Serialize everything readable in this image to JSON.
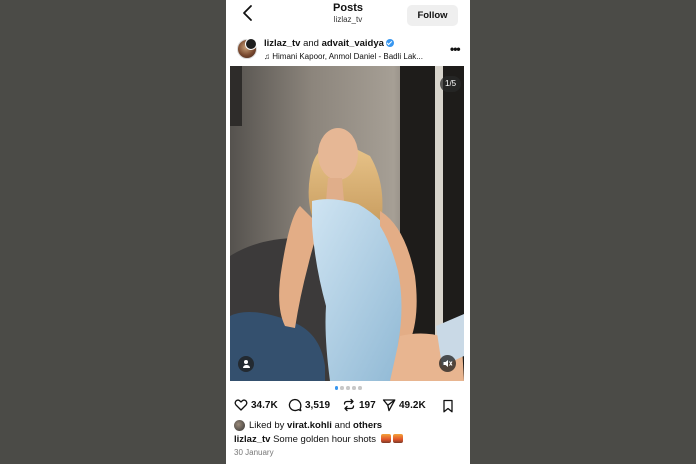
{
  "topbar": {
    "title": "Posts",
    "subtitle": "lizlaz_tv",
    "follow_label": "Follow",
    "back_icon": "chevron-left-icon"
  },
  "post_header": {
    "user1": "lizlaz_tv",
    "connector": " and ",
    "user2": "advait_vaidya",
    "audio": "♫ Himani Kapoor, Anmol Daniel - Badli Lak...",
    "more_label": "•••"
  },
  "media": {
    "counter": "1/5",
    "total_slides": 5,
    "current_slide": 1
  },
  "actions": {
    "likes": "34.7K",
    "comments": "3,519",
    "reposts": "197",
    "shares": "49.2K"
  },
  "liked_by": {
    "prefix": "Liked by ",
    "user": "virat.kohli",
    "middle": " and ",
    "suffix": "others"
  },
  "caption": {
    "user": "lizlaz_tv",
    "text": " Some golden hour shots "
  },
  "date": "30 January",
  "colors": {
    "accent": "#3897f0",
    "follow_bg": "#efefef",
    "backdrop": "#4b4b47"
  }
}
